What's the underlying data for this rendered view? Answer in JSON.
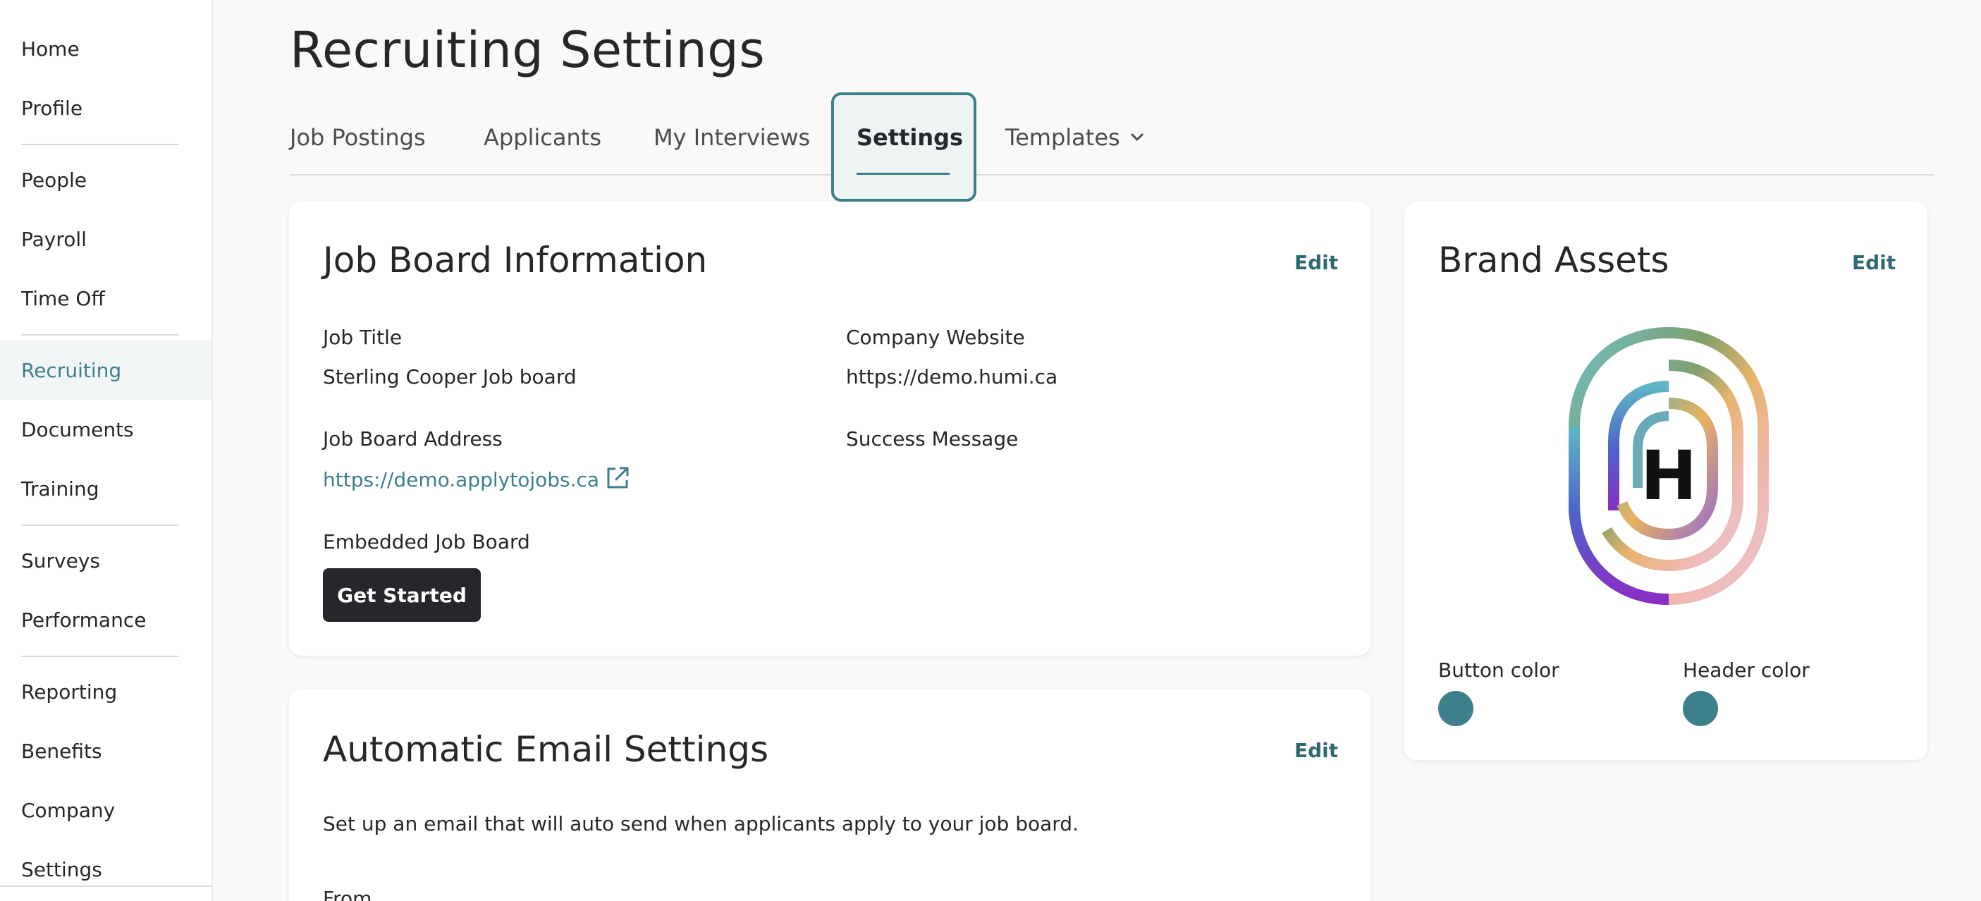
{
  "sidebar": {
    "items": [
      {
        "label": "Home"
      },
      {
        "label": "Profile"
      },
      {
        "label": "People"
      },
      {
        "label": "Payroll"
      },
      {
        "label": "Time Off"
      },
      {
        "label": "Recruiting"
      },
      {
        "label": "Documents"
      },
      {
        "label": "Training"
      },
      {
        "label": "Surveys"
      },
      {
        "label": "Performance"
      },
      {
        "label": "Reporting"
      },
      {
        "label": "Benefits"
      },
      {
        "label": "Company"
      },
      {
        "label": "Settings"
      }
    ],
    "active": "Recruiting"
  },
  "page": {
    "title": "Recruiting Settings"
  },
  "tabs": [
    {
      "label": "Job Postings"
    },
    {
      "label": "Applicants"
    },
    {
      "label": "My Interviews"
    },
    {
      "label": "Settings"
    },
    {
      "label": "Templates"
    }
  ],
  "job_board": {
    "title": "Job Board Information",
    "edit_label": "Edit",
    "job_title_label": "Job Title",
    "job_title_value": "Sterling Cooper Job board",
    "company_website_label": "Company Website",
    "company_website_value": "https://demo.humi.ca",
    "address_label": "Job Board Address",
    "address_value": "https://demo.applytojobs.ca",
    "success_message_label": "Success Message",
    "embedded_label": "Embedded Job Board",
    "get_started_label": "Get Started"
  },
  "brand_assets": {
    "title": "Brand Assets",
    "edit_label": "Edit",
    "logo_letter": "H",
    "button_color_label": "Button color",
    "header_color_label": "Header color",
    "button_color": "#3d7f8a",
    "header_color": "#3d7f8a"
  },
  "auto_email": {
    "title": "Automatic Email Settings",
    "edit_label": "Edit",
    "description": "Set up an email that will auto send when applicants apply to your job board.",
    "from_label": "From"
  },
  "colors": {
    "accent": "#3d7f8a",
    "dark_button": "#26272b"
  }
}
